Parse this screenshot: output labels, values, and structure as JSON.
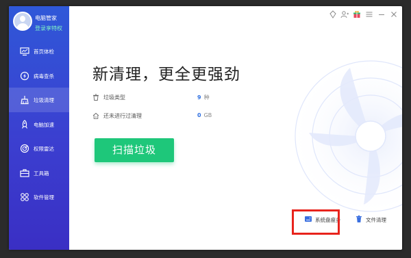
{
  "user": {
    "name": "电脑管家",
    "privilege": "登录享特权"
  },
  "sidebar": {
    "items": [
      {
        "label": "首页体检",
        "icon": "monitor-icon"
      },
      {
        "label": "病毒查杀",
        "icon": "shield-bolt-icon"
      },
      {
        "label": "垃圾清理",
        "icon": "broom-icon",
        "active": true
      },
      {
        "label": "电脑加速",
        "icon": "rocket-icon"
      },
      {
        "label": "权限雷达",
        "icon": "radar-icon"
      },
      {
        "label": "工具箱",
        "icon": "toolbox-icon"
      },
      {
        "label": "软件管理",
        "icon": "apps-icon"
      }
    ]
  },
  "topbar": {
    "icons": [
      "skin-icon",
      "user-switch-icon",
      "gift-icon",
      "menu-icon",
      "minimize-icon",
      "close-icon"
    ]
  },
  "main": {
    "headline": "新清理，更全更强劲",
    "stats": [
      {
        "label": "垃圾类型",
        "value": "9",
        "unit": "种"
      },
      {
        "label": "还未进行过清理",
        "value": "0",
        "unit": "GB"
      }
    ],
    "scan_button": "扫描垃圾"
  },
  "tools": [
    {
      "label": "系统盘瘦身",
      "icon": "disk-icon"
    },
    {
      "label": "文件清理",
      "icon": "trash-icon"
    }
  ],
  "colors": {
    "sidebar": "#3348d4",
    "accent_green": "#1ec77a",
    "highlight_red": "#e8231c",
    "value_blue": "#2f6fe0"
  }
}
